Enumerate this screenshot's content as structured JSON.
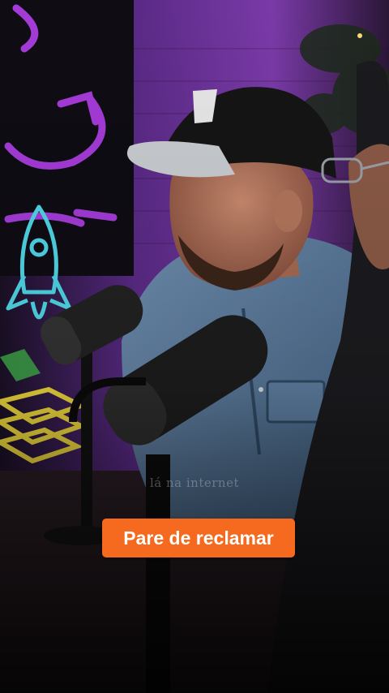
{
  "video": {
    "watermark_text": "lá na internet",
    "caption_text": "Pare de reclamar"
  },
  "colors": {
    "caption_bg": "#f56a1e",
    "neon_purple": "#a43bd8",
    "neon_cyan": "#4fd6e6",
    "neon_yellow": "#e8d23a",
    "backdrop": "#5a2a86"
  }
}
